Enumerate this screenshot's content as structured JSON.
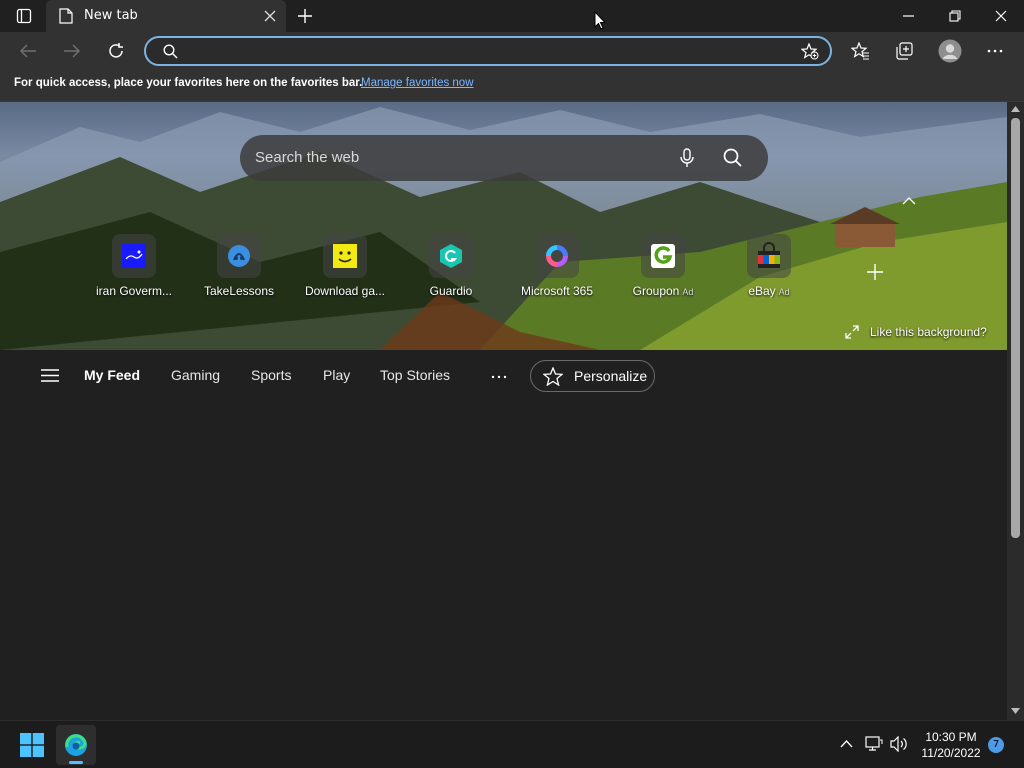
{
  "browser": {
    "tab_title": "New tab",
    "address_value": "",
    "favorites_message": "For quick access, place your favorites here on the favorites bar.",
    "favorites_link": "Manage favorites now"
  },
  "hero": {
    "search_placeholder": "Search the web",
    "like_background": "Like this background?",
    "tiles": [
      {
        "label": "iran Goverm...",
        "ad": ""
      },
      {
        "label": "TakeLessons",
        "ad": ""
      },
      {
        "label": "Download ga...",
        "ad": ""
      },
      {
        "label": "Guardio",
        "ad": ""
      },
      {
        "label": "Microsoft 365",
        "ad": ""
      },
      {
        "label": "Groupon",
        "ad": "Ad"
      },
      {
        "label": "eBay",
        "ad": "Ad"
      }
    ]
  },
  "feed": {
    "tabs": [
      "My Feed",
      "Gaming",
      "Sports",
      "Play",
      "Top Stories"
    ],
    "personalize": "Personalize"
  },
  "taskbar": {
    "time": "10:30 PM",
    "date": "11/20/2022",
    "notification_count": "7"
  },
  "colors": {
    "accent": "#7bb4e3",
    "link": "#7cb6ff",
    "background": "#202020"
  }
}
